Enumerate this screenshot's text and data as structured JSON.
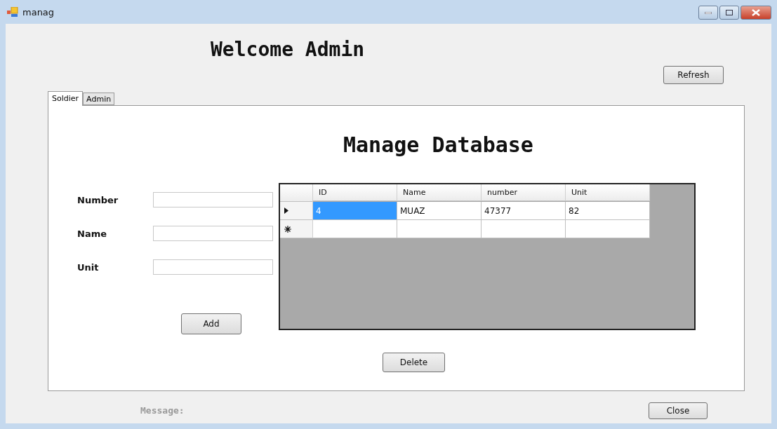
{
  "window": {
    "title": "manag"
  },
  "heading": "Welcome Admin",
  "refresh_button": "Refresh",
  "tabs": [
    {
      "label": "Soldier",
      "selected": true
    },
    {
      "label": "Admin",
      "selected": false
    }
  ],
  "panel_title": "Manage Database",
  "fields": [
    {
      "label": "Number"
    },
    {
      "label": "Name"
    },
    {
      "label": "Unit"
    }
  ],
  "add_button": "Add",
  "table": {
    "columns": [
      "ID",
      "Name",
      "number",
      "Unit"
    ],
    "rows": [
      {
        "kind": "current",
        "cells": [
          {
            "text": "4",
            "selected": true
          },
          {
            "text": "MUAZ",
            "selected": false
          },
          {
            "text": "47377",
            "selected": false
          },
          {
            "text": "82",
            "selected": false
          }
        ]
      },
      {
        "kind": "new",
        "cells": [
          {
            "selected": false
          },
          {
            "selected": false
          },
          {
            "selected": false
          },
          {
            "selected": false
          }
        ]
      }
    ]
  },
  "delete_button": "Delete",
  "message": "Message:",
  "close_button": "Close"
}
